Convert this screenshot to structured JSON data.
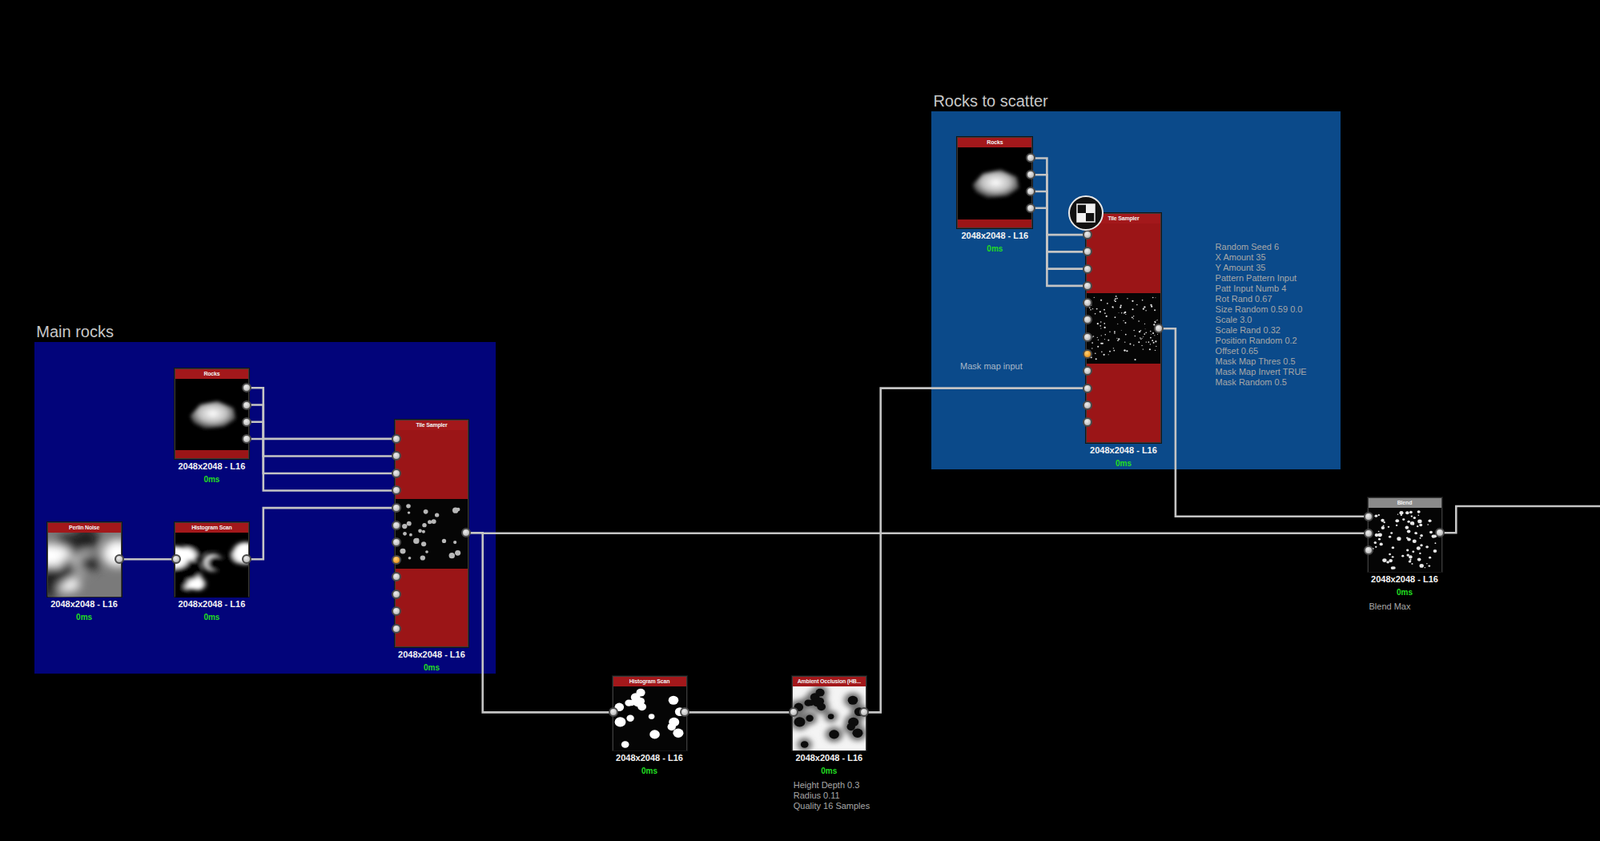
{
  "canvas": {
    "frames": [
      {
        "title": "Main rocks",
        "color": "#02047a",
        "comments": []
      },
      {
        "title": "Rocks to scatter",
        "color": "#0b4a8a",
        "comments": [
          "Mask map input"
        ]
      }
    ],
    "nodes": [
      {
        "title": "Rocks",
        "kind": "rocks",
        "color": "#a3181b",
        "resolution": "2048x2048 - L16",
        "time": "0ms",
        "badge": false,
        "inputs": [],
        "outputs": [
          {
            "highlighted": false
          },
          {
            "highlighted": false
          },
          {
            "highlighted": false
          },
          {
            "highlighted": false
          }
        ],
        "params": []
      },
      {
        "title": "Perlin Noise",
        "kind": "perlin",
        "color": "#a3181b",
        "resolution": "2048x2048 - L16",
        "time": "0ms",
        "badge": false,
        "inputs": [],
        "outputs": [
          {
            "highlighted": false
          }
        ],
        "params": []
      },
      {
        "title": "Histogram Scan",
        "kind": "histogram",
        "color": "#a3181b",
        "resolution": "2048x2048 - L16",
        "time": "0ms",
        "badge": false,
        "inputs": [
          {
            "highlighted": false
          }
        ],
        "outputs": [
          {
            "highlighted": false
          }
        ],
        "params": []
      },
      {
        "title": "Tile Sampler",
        "kind": "tile-sampler",
        "color": "#a3181b",
        "resolution": "2048x2048 - L16",
        "time": "0ms",
        "badge": false,
        "inputs": [
          {
            "highlighted": false
          },
          {
            "highlighted": false
          },
          {
            "highlighted": false
          },
          {
            "highlighted": false
          },
          {
            "highlighted": false
          },
          {
            "highlighted": false
          },
          {
            "highlighted": false
          },
          {
            "highlighted": true
          },
          {
            "highlighted": false
          },
          {
            "highlighted": false
          },
          {
            "highlighted": false
          },
          {
            "highlighted": false
          }
        ],
        "outputs": [
          {
            "highlighted": false
          }
        ],
        "params": []
      },
      {
        "title": "Histogram Scan",
        "kind": "histogram-blobs",
        "color": "#a3181b",
        "resolution": "2048x2048 - L16",
        "time": "0ms",
        "badge": false,
        "inputs": [
          {
            "highlighted": false
          }
        ],
        "outputs": [
          {
            "highlighted": false
          }
        ],
        "params": []
      },
      {
        "title": "Ambient Occlusion (HB...",
        "kind": "ambient-occlusion",
        "color": "#a3181b",
        "resolution": "2048x2048 - L16",
        "time": "0ms",
        "badge": false,
        "inputs": [
          {
            "highlighted": false
          }
        ],
        "outputs": [
          {
            "highlighted": false
          }
        ],
        "params": [
          "Height Depth 0.3",
          "Radius 0.11",
          "Quality 16 Samples"
        ]
      },
      {
        "title": "Rocks",
        "kind": "rocks",
        "color": "#a3181b",
        "resolution": "2048x2048 - L16",
        "time": "0ms",
        "badge": false,
        "inputs": [],
        "outputs": [
          {
            "highlighted": false
          },
          {
            "highlighted": false
          },
          {
            "highlighted": false
          },
          {
            "highlighted": false
          }
        ],
        "params": []
      },
      {
        "title": "Tile Sampler",
        "kind": "tile-sampler-scatter",
        "color": "#a3181b",
        "resolution": "2048x2048 - L16",
        "time": "0ms",
        "badge": true,
        "inputs": [
          {
            "highlighted": false
          },
          {
            "highlighted": false
          },
          {
            "highlighted": false
          },
          {
            "highlighted": false
          },
          {
            "highlighted": false
          },
          {
            "highlighted": false
          },
          {
            "highlighted": false
          },
          {
            "highlighted": true
          },
          {
            "highlighted": false
          },
          {
            "highlighted": false
          },
          {
            "highlighted": false
          },
          {
            "highlighted": false
          }
        ],
        "outputs": [
          {
            "highlighted": false
          }
        ],
        "params": [
          "Random Seed 6",
          "X Amount 35",
          "Y Amount 35",
          "Pattern Pattern Input",
          "Patt Input Numb 4",
          "Rot Rand 0.67",
          "Size Random 0.59 0.0",
          "Scale 3.0",
          "Scale Rand 0.32",
          "Position Random 0.2",
          "Offset 0.65",
          "Mask Map Thres 0.5",
          "Mask Map Invert TRUE",
          "Mask Random 0.5"
        ]
      },
      {
        "title": "Blend",
        "kind": "blend",
        "color": "#8a8a8a",
        "resolution": "2048x2048 - L16",
        "time": "0ms",
        "badge": false,
        "inputs": [
          {
            "highlighted": false
          },
          {
            "highlighted": false
          },
          {
            "highlighted": false
          }
        ],
        "outputs": [
          {
            "highlighted": false
          }
        ],
        "params": [
          "Blend Max"
        ]
      }
    ],
    "links": [
      {
        "from": {
          "node": 0,
          "pin": 0
        },
        "to": {
          "node": 3,
          "pin": 0
        }
      },
      {
        "from": {
          "node": 0,
          "pin": 1
        },
        "to": {
          "node": 3,
          "pin": 1
        }
      },
      {
        "from": {
          "node": 0,
          "pin": 2
        },
        "to": {
          "node": 3,
          "pin": 2
        }
      },
      {
        "from": {
          "node": 0,
          "pin": 3
        },
        "to": {
          "node": 3,
          "pin": 3
        }
      },
      {
        "from": {
          "node": 1,
          "pin": 0
        },
        "to": {
          "node": 2,
          "pin": 0
        }
      },
      {
        "from": {
          "node": 2,
          "pin": 0
        },
        "to": {
          "node": 3,
          "pin": 4
        }
      },
      {
        "from": {
          "node": 3,
          "pin": 0
        },
        "to": {
          "node": 8,
          "pin": 1
        }
      },
      {
        "from": {
          "node": 3,
          "pin": 0
        },
        "to": {
          "node": 4,
          "pin": 0
        }
      },
      {
        "from": {
          "node": 4,
          "pin": 0
        },
        "to": {
          "node": 5,
          "pin": 0
        }
      },
      {
        "from": {
          "node": 5,
          "pin": 0
        },
        "to": {
          "node": 7,
          "pin": 9
        }
      },
      {
        "from": {
          "node": 6,
          "pin": 0
        },
        "to": {
          "node": 7,
          "pin": 0
        }
      },
      {
        "from": {
          "node": 6,
          "pin": 1
        },
        "to": {
          "node": 7,
          "pin": 1
        }
      },
      {
        "from": {
          "node": 6,
          "pin": 2
        },
        "to": {
          "node": 7,
          "pin": 2
        }
      },
      {
        "from": {
          "node": 6,
          "pin": 3
        },
        "to": {
          "node": 7,
          "pin": 3
        }
      },
      {
        "from": {
          "node": 7,
          "pin": 0
        },
        "to": {
          "node": 8,
          "pin": 0
        }
      },
      {
        "from": {
          "node": 8,
          "pin": 0
        },
        "to": null
      }
    ]
  }
}
